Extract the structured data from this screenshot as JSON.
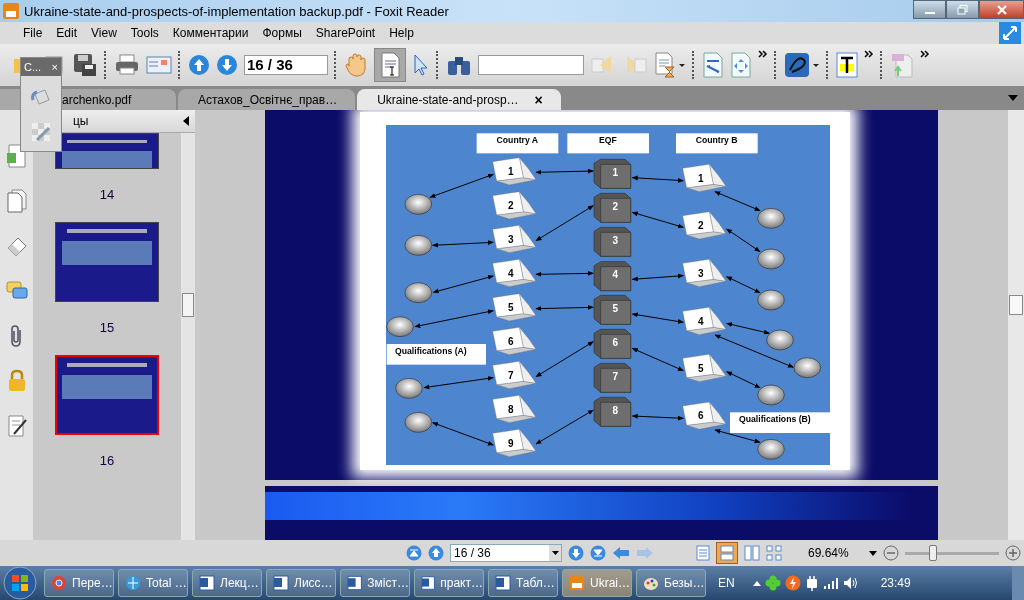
{
  "window": {
    "title": "Ukraine-state-and-prospects-of-implementation backup.pdf - Foxit Reader"
  },
  "menu": [
    "File",
    "Edit",
    "View",
    "Tools",
    "Комментарии",
    "Формы",
    "SharePoint",
    "Help"
  ],
  "toolbar": {
    "page_field": "16 / 36"
  },
  "popup": {
    "title": "C...",
    "close": "×"
  },
  "tabs": [
    {
      "label": "archenko.pdf",
      "selected": false
    },
    {
      "label": "Астахов_Освітнє_прав…",
      "selected": false
    },
    {
      "label": "Ukraine-state-and-prosp…",
      "selected": true,
      "close": "×"
    }
  ],
  "panel": {
    "title": "цы",
    "thumbnails": [
      {
        "page": "14",
        "selected": false
      },
      {
        "page": "15",
        "selected": false
      },
      {
        "page": "16",
        "selected": true
      }
    ]
  },
  "diagram": {
    "headers": [
      "Country A",
      "EQF",
      "Country B"
    ],
    "country_a": [
      "1",
      "2",
      "3",
      "4",
      "5",
      "6",
      "7",
      "8",
      "9"
    ],
    "eqf": [
      "1",
      "2",
      "3",
      "4",
      "5",
      "6",
      "7",
      "8"
    ],
    "country_b": [
      "1",
      "2",
      "3",
      "4",
      "5",
      "6"
    ],
    "label_a": "Qualifications (A)",
    "label_b": "Qualifications (B)"
  },
  "status_bar": {
    "page_field": "16 / 36",
    "zoom": "69.64%",
    "zoom_slider": {
      "level": 0.3
    }
  },
  "taskbar": {
    "items": [
      {
        "label": "Пере…",
        "kind": "browser",
        "selected": false
      },
      {
        "label": "Total …",
        "kind": "files",
        "selected": false
      },
      {
        "label": "Лекц…",
        "kind": "word",
        "selected": false
      },
      {
        "label": "Лисс…",
        "kind": "word",
        "selected": false
      },
      {
        "label": "Зміст…",
        "kind": "word",
        "selected": false
      },
      {
        "label": "практ…",
        "kind": "word",
        "selected": false
      },
      {
        "label": "Табл…",
        "kind": "word",
        "selected": false
      },
      {
        "label": "Ukrai…",
        "kind": "pdf",
        "selected": true
      },
      {
        "label": "Безы…",
        "kind": "paint",
        "selected": false
      }
    ],
    "language": "EN",
    "clock": "23:49"
  }
}
